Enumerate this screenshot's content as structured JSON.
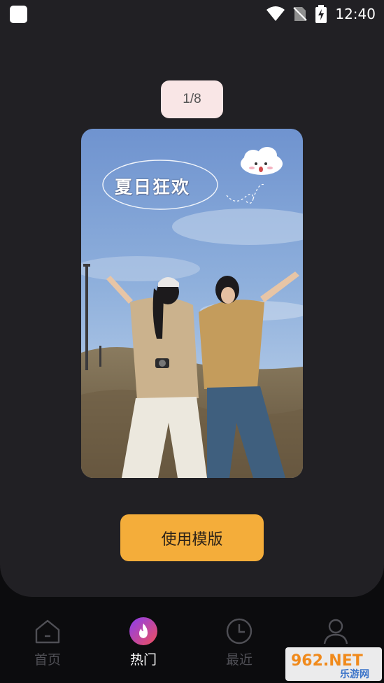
{
  "status_bar": {
    "time": "12:40"
  },
  "pager": {
    "indicator": "1/8"
  },
  "template": {
    "title": "夏日狂欢"
  },
  "actions": {
    "use_template_label": "使用模版"
  },
  "nav": {
    "items": [
      {
        "label": "首页",
        "icon": "home-icon",
        "active": false
      },
      {
        "label": "热门",
        "icon": "flame-icon",
        "active": true
      },
      {
        "label": "最近",
        "icon": "clock-icon",
        "active": false
      },
      {
        "label": "",
        "icon": "person-icon",
        "active": false
      }
    ]
  },
  "watermark": {
    "text_main": "962.NET",
    "text_sub": "乐游网"
  },
  "colors": {
    "panel": "#212024",
    "background": "#0c0c0e",
    "accent_button": "#f4ad3a",
    "indicator_bg": "#f9e6e6",
    "active_icon_gradient": [
      "#8a3df2",
      "#f0505a"
    ]
  }
}
